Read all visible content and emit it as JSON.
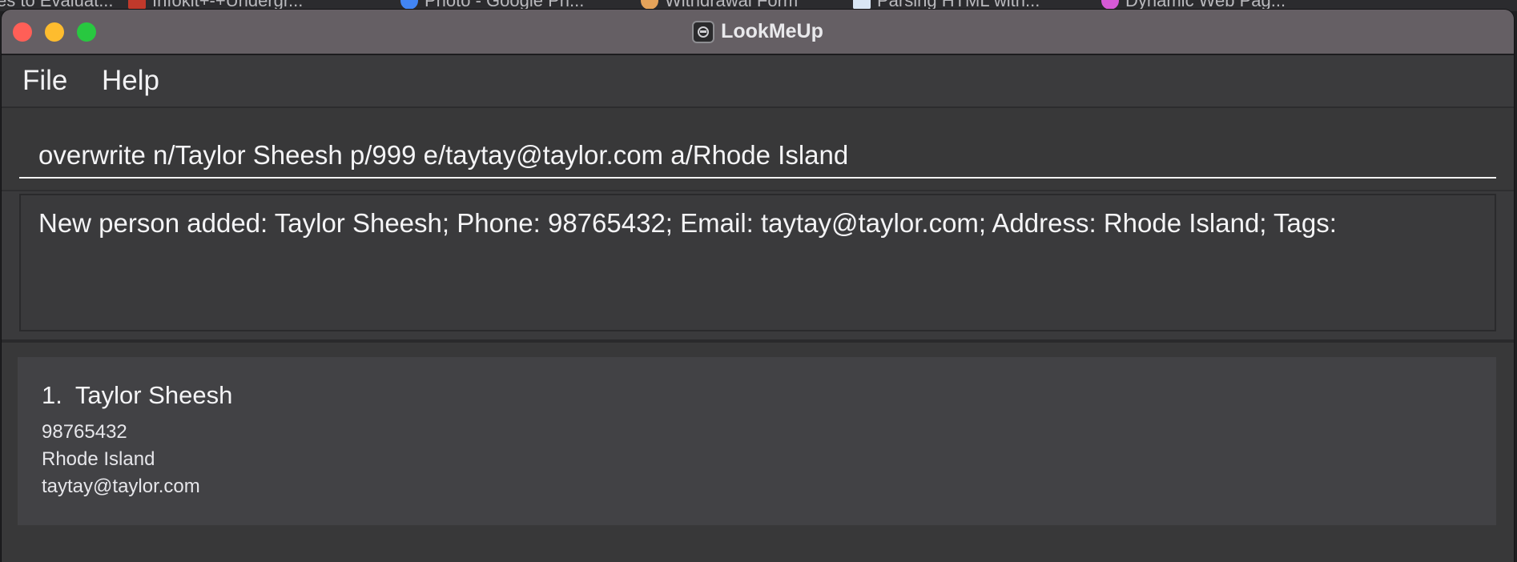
{
  "browser_tabs": [
    {
      "label": "es to Evaluat...",
      "favicon_color": null
    },
    {
      "label": "Infokit+-+Undergr...",
      "favicon_color": "#c0392b"
    },
    {
      "label": "Photo - Google Ph...",
      "favicon_color": "#4285f4"
    },
    {
      "label": "Withdrawal Form",
      "favicon_color": "#e5a35a"
    },
    {
      "label": "Parsing HTML with...",
      "favicon_color": "#5aa0e5"
    },
    {
      "label": "Dynamic Web Pag...",
      "favicon_color": "#d65ad6"
    }
  ],
  "window": {
    "title": "LookMeUp",
    "app_icon": "app-icon"
  },
  "menu": {
    "items": [
      {
        "label": "File"
      },
      {
        "label": "Help"
      }
    ]
  },
  "command_box": {
    "value": "overwrite n/Taylor Sheesh p/999 e/taytay@taylor.com a/Rhode Island"
  },
  "result_display": {
    "text": "New person added: Taylor Sheesh; Phone: 98765432; Email: taytay@taylor.com; Address: Rhode Island; Tags:"
  },
  "person_list": [
    {
      "index": "1.",
      "name": "Taylor Sheesh",
      "phone": "98765432",
      "address": "Rhode Island",
      "email": "taytay@taylor.com"
    }
  ],
  "colors": {
    "titlebar": "#655f64",
    "window_bg": "#3a3a3c",
    "card_bg": "#424245",
    "text": "#f4f4f6",
    "close": "#ff5f57",
    "minimize": "#febc2e",
    "maximize": "#28c840"
  }
}
